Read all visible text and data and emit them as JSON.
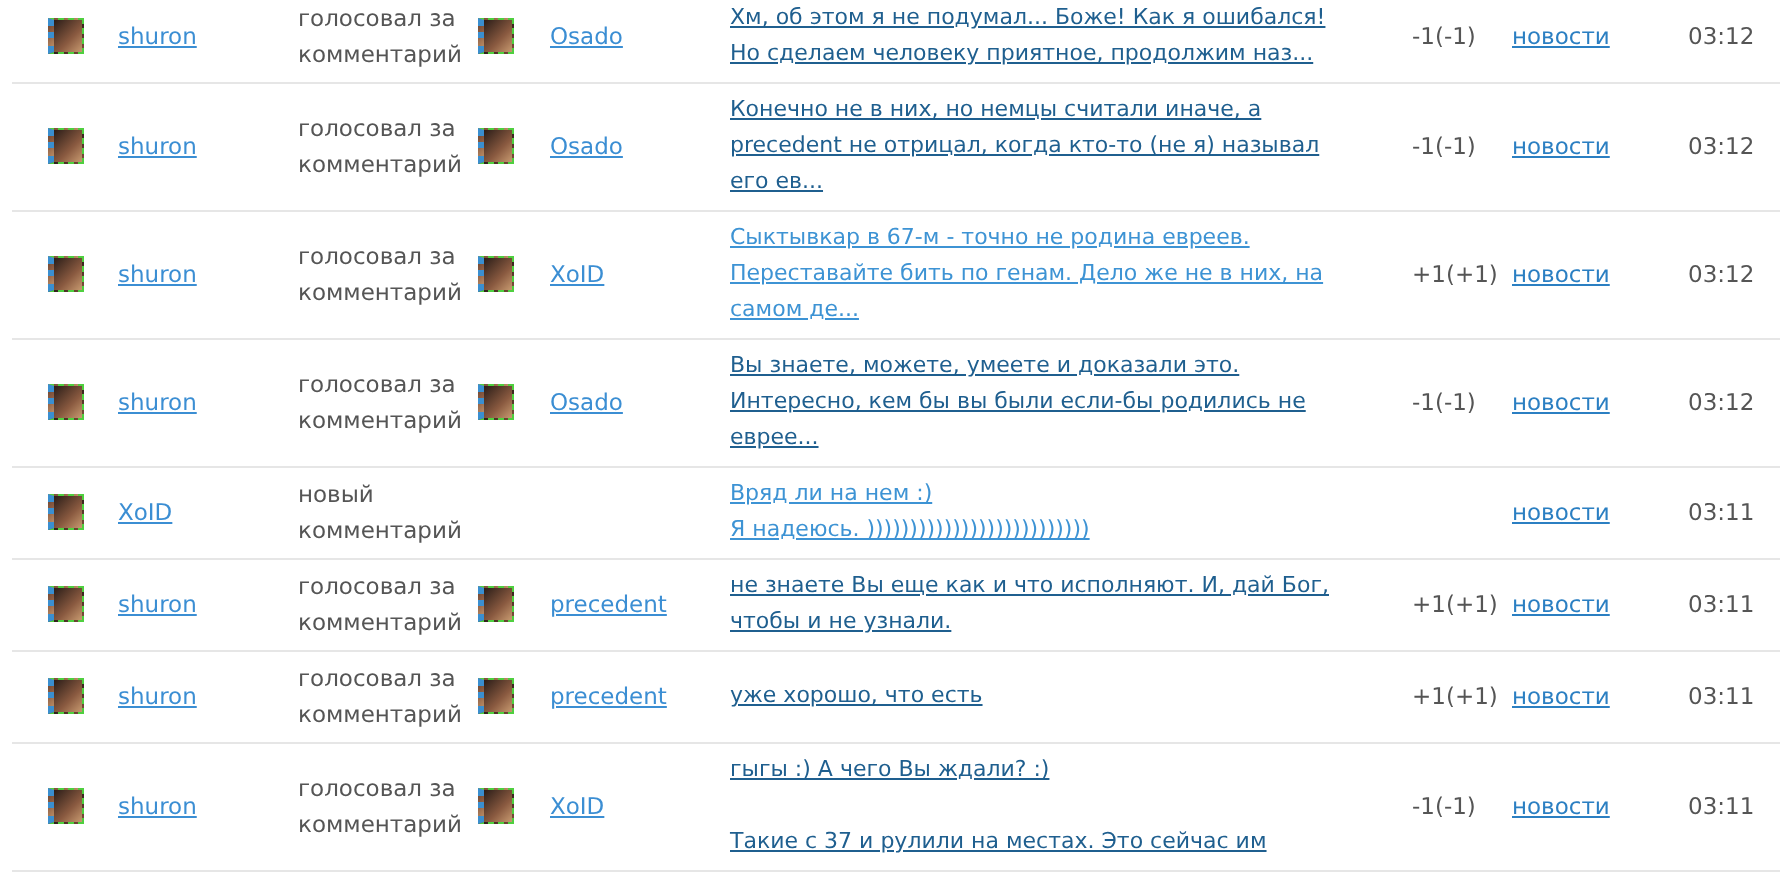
{
  "rows": [
    {
      "user": "shuron",
      "action": [
        "голосовал за",
        "комментарий"
      ],
      "target": "Osado",
      "comment": {
        "visited": true,
        "paragraphs": [
          [
            "Хм, об этом я не подумал... Боже! Как я ошибался!",
            "Но сделаем человеку приятное, продолжим наз..."
          ]
        ]
      },
      "score": "-1(-1)",
      "section": "новости",
      "time": "03:12"
    },
    {
      "user": "shuron",
      "action": [
        "голосовал за",
        "комментарий"
      ],
      "target": "Osado",
      "comment": {
        "visited": true,
        "paragraphs": [
          [
            "Конечно не в них, но немцы считали иначе, а",
            "precedent не отрицал, когда кто-то (не я) называл",
            "его ев..."
          ]
        ]
      },
      "score": "-1(-1)",
      "section": "новости",
      "time": "03:12"
    },
    {
      "user": "shuron",
      "action": [
        "голосовал за",
        "комментарий"
      ],
      "target": "XoID",
      "comment": {
        "visited": false,
        "paragraphs": [
          [
            "Сыктывкар в 67-м - точно не родина евреев.",
            "Переставайте бить по генам. Дело же не в них, на",
            "самом де..."
          ]
        ]
      },
      "score": "+1(+1)",
      "section": "новости",
      "time": "03:12"
    },
    {
      "user": "shuron",
      "action": [
        "голосовал за",
        "комментарий"
      ],
      "target": "Osado",
      "comment": {
        "visited": true,
        "paragraphs": [
          [
            "Вы знаете, можете, умеете и доказали это.",
            "Интересно, кем бы вы были если-бы родились не",
            "евреe..."
          ]
        ]
      },
      "score": "-1(-1)",
      "section": "новости",
      "time": "03:12"
    },
    {
      "user": "XoID",
      "action": [
        "новый",
        "комментарий"
      ],
      "comment": {
        "visited": false,
        "paragraphs": [
          [
            "Вряд ли на нем :)",
            "Я надеюсь. ))))))))))))))))))))))))))"
          ]
        ]
      },
      "section": "новости",
      "time": "03:11"
    },
    {
      "user": "shuron",
      "action": [
        "голосовал за",
        "комментарий"
      ],
      "target": "precedent",
      "comment": {
        "visited": true,
        "paragraphs": [
          [
            "не знаете Вы еще как и что исполняют. И, дай Бог,",
            "чтобы и не узнали."
          ]
        ]
      },
      "score": "+1(+1)",
      "section": "новости",
      "time": "03:11"
    },
    {
      "user": "shuron",
      "action": [
        "голосовал за",
        "комментарий"
      ],
      "target": "precedent",
      "comment": {
        "visited": true,
        "paragraphs": [
          [
            "уже хорошо, что есть"
          ]
        ]
      },
      "score": "+1(+1)",
      "section": "новости",
      "time": "03:11"
    },
    {
      "user": "shuron",
      "action": [
        "голосовал за",
        "комментарий"
      ],
      "target": "XoID",
      "comment": {
        "visited": true,
        "paragraphs": [
          [
            "гыгы :) А чего Вы ждали? :)"
          ],
          [
            "Такие с 37 и рулили на местах. Это сейчас им"
          ]
        ]
      },
      "score": "-1(-1)",
      "section": "новости",
      "time": "03:11"
    }
  ]
}
